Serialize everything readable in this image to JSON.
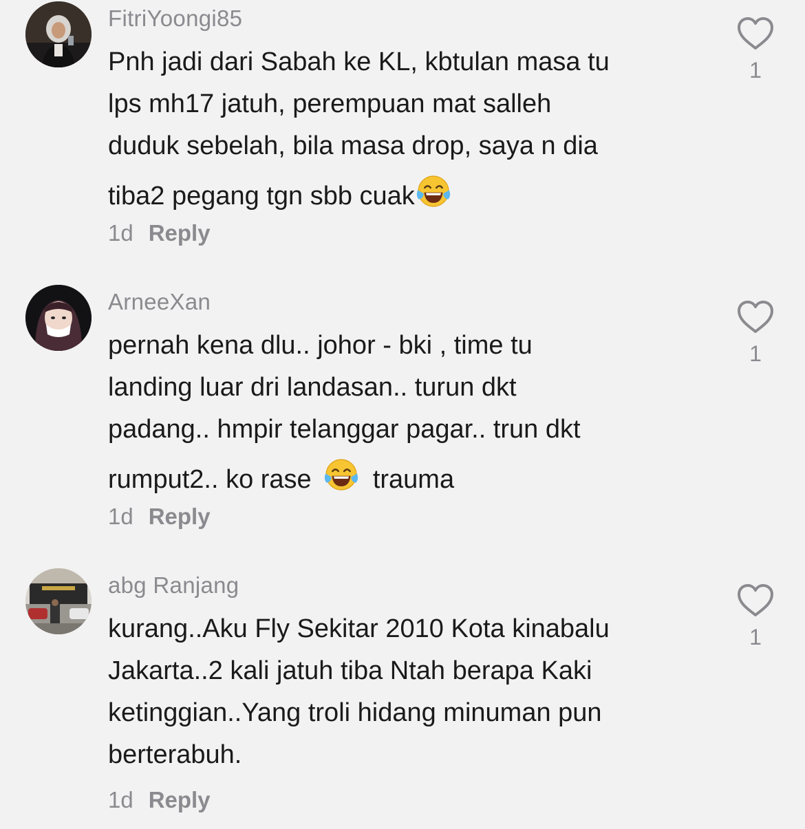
{
  "comments": [
    {
      "username": "FitriYoongi85",
      "lines": [
        "Pnh jadi dari Sabah ke KL, kbtulan masa tu",
        "lps mh17 jatuh, perempuan mat salleh",
        "duduk sebelah, bila masa drop, saya n dia",
        "tiba2 pegang tgn sbb cuak"
      ],
      "time": "1d",
      "reply_label": "Reply",
      "likes": "1",
      "avatar_icon": "user-avatar-hijab-graduation"
    },
    {
      "username": "ArneeXan",
      "lines": [
        "pernah kena dlu.. johor - bki , time tu",
        "landing luar dri landasan.. turun dkt",
        "padang.. hmpir telanggar pagar.. trun dkt",
        "rumput2.. ko rase",
        "trauma"
      ],
      "time": "1d",
      "reply_label": "Reply",
      "likes": "1",
      "avatar_icon": "user-avatar-hijab"
    },
    {
      "username": "abg Ranjang",
      "lines": [
        "kurang..Aku Fly Sekitar 2010 Kota kinabalu",
        "Jakarta..2 kali jatuh tiba Ntah berapa Kaki",
        "ketinggian..Yang troli hidang minuman pun",
        "berterabuh."
      ],
      "time": "1d",
      "reply_label": "Reply",
      "likes": "1",
      "avatar_icon": "user-avatar-storefront"
    }
  ],
  "icons": {
    "like": "heart-outline-icon",
    "emoji": "tears-of-joy-emoji"
  },
  "colors": {
    "background": "#f2f2f2",
    "text": "#1a1a1a",
    "muted": "#8a8a8f"
  }
}
